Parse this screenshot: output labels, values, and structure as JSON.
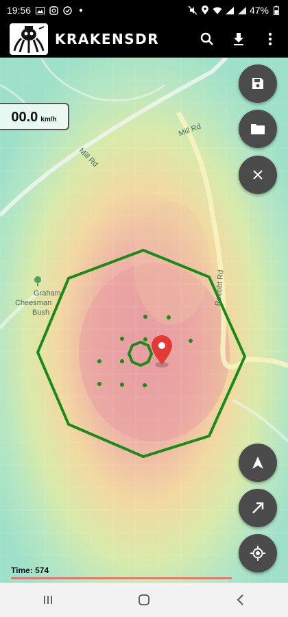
{
  "status_bar": {
    "time": "19:56",
    "battery": "47%"
  },
  "app": {
    "title": "KRAKENSDR",
    "logo_icon": "kraken-logo-icon"
  },
  "toolbar": {
    "actions": [
      "search-icon",
      "download-icon",
      "overflow-menu-icon"
    ]
  },
  "speed": {
    "value": "00.0",
    "unit": "km/h"
  },
  "map_labels": {
    "mill_rd_top": "Mill Rd",
    "mill_rd_left": "Mill Rd",
    "park_line1": "Graham",
    "park_line2": "Cheesman",
    "park_line3": "Bush",
    "road_right": "Roebbt Rd"
  },
  "fabs": {
    "save": "save-icon",
    "open": "folder-icon",
    "clear": "close-icon",
    "north": "navigation-arrow-icon",
    "direction": "diagonal-arrow-icon",
    "locate": "my-location-icon"
  },
  "playback": {
    "time_label": "Time: 574",
    "progress": 0.77
  },
  "colors": {
    "heat_hot": "#e9a0a0",
    "heat_warm": "#f0d69a",
    "heat_cool": "#aee5c6",
    "octagon": "#1a8a1a",
    "marker": "#e53935",
    "fab_bg": "#4b4b4b",
    "progress": "#ff6b6b"
  },
  "navigation": [
    "recents-icon",
    "home-icon",
    "back-icon"
  ]
}
